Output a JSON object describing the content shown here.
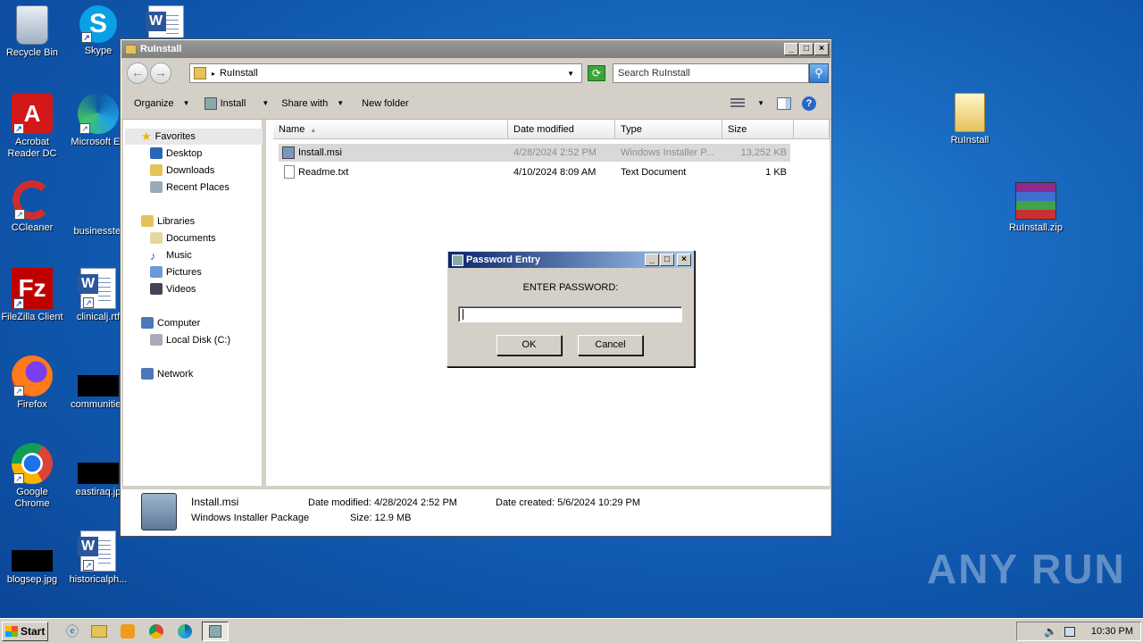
{
  "desktop_icons": [
    {
      "name": "recycle-bin-icon",
      "label": "Recycle Bin"
    },
    {
      "name": "skype-icon",
      "label": "Skype"
    },
    {
      "name": "acrobat-icon",
      "label": "Acrobat Reader DC"
    },
    {
      "name": "edge-icon",
      "label": "Microsoft Ed"
    },
    {
      "name": "ccleaner-icon",
      "label": "CCleaner"
    },
    {
      "name": "businesstel-icon",
      "label": "businesstel"
    },
    {
      "name": "filezilla-icon",
      "label": "FileZilla Client"
    },
    {
      "name": "clinical-rtf-icon",
      "label": "clinicalj.rtf"
    },
    {
      "name": "firefox-icon",
      "label": "Firefox"
    },
    {
      "name": "communities-icon",
      "label": "communities"
    },
    {
      "name": "chrome-icon",
      "label": "Google Chrome"
    },
    {
      "name": "eastiraq-icon",
      "label": "eastiraq.jp"
    },
    {
      "name": "blogsep-icon",
      "label": "blogsep.jpg"
    },
    {
      "name": "historicalph-icon",
      "label": "historicalph..."
    },
    {
      "name": "ruinstall-folder-icon",
      "label": "RuInstall"
    },
    {
      "name": "ruinstall-zip-icon",
      "label": "RuInstall.zip"
    }
  ],
  "explorer": {
    "title": "RuInstall",
    "address": "RuInstall",
    "search_placeholder": "Search RuInstall",
    "toolbar": {
      "organize": "Organize",
      "install": "Install",
      "share": "Share with",
      "newfolder": "New folder"
    },
    "nav": {
      "favorites": "Favorites",
      "desktop": "Desktop",
      "downloads": "Downloads",
      "recent": "Recent Places",
      "libraries": "Libraries",
      "documents": "Documents",
      "music": "Music",
      "pictures": "Pictures",
      "videos": "Videos",
      "computer": "Computer",
      "localdisk": "Local Disk (C:)",
      "network": "Network"
    },
    "columns": {
      "name": "Name",
      "date": "Date modified",
      "type": "Type",
      "size": "Size"
    },
    "files": [
      {
        "name": "Install.msi",
        "date": "4/28/2024 2:52 PM",
        "type": "Windows Installer P...",
        "size": "13,252 KB"
      },
      {
        "name": "Readme.txt",
        "date": "4/10/2024 8:09 AM",
        "type": "Text Document",
        "size": "1 KB"
      }
    ],
    "status": {
      "filename": "Install.msi",
      "filetype": "Windows Installer Package",
      "modified": "Date modified: 4/28/2024 2:52 PM",
      "size": "Size: 12.9 MB",
      "created": "Date created: 5/6/2024 10:29 PM"
    }
  },
  "dialog": {
    "title": "Password Entry",
    "prompt": "ENTER PASSWORD:",
    "password_value": "",
    "ok": "OK",
    "cancel": "Cancel"
  },
  "taskbar": {
    "start": "Start",
    "clock": "10:30 PM"
  },
  "watermark": "ANY RUN"
}
